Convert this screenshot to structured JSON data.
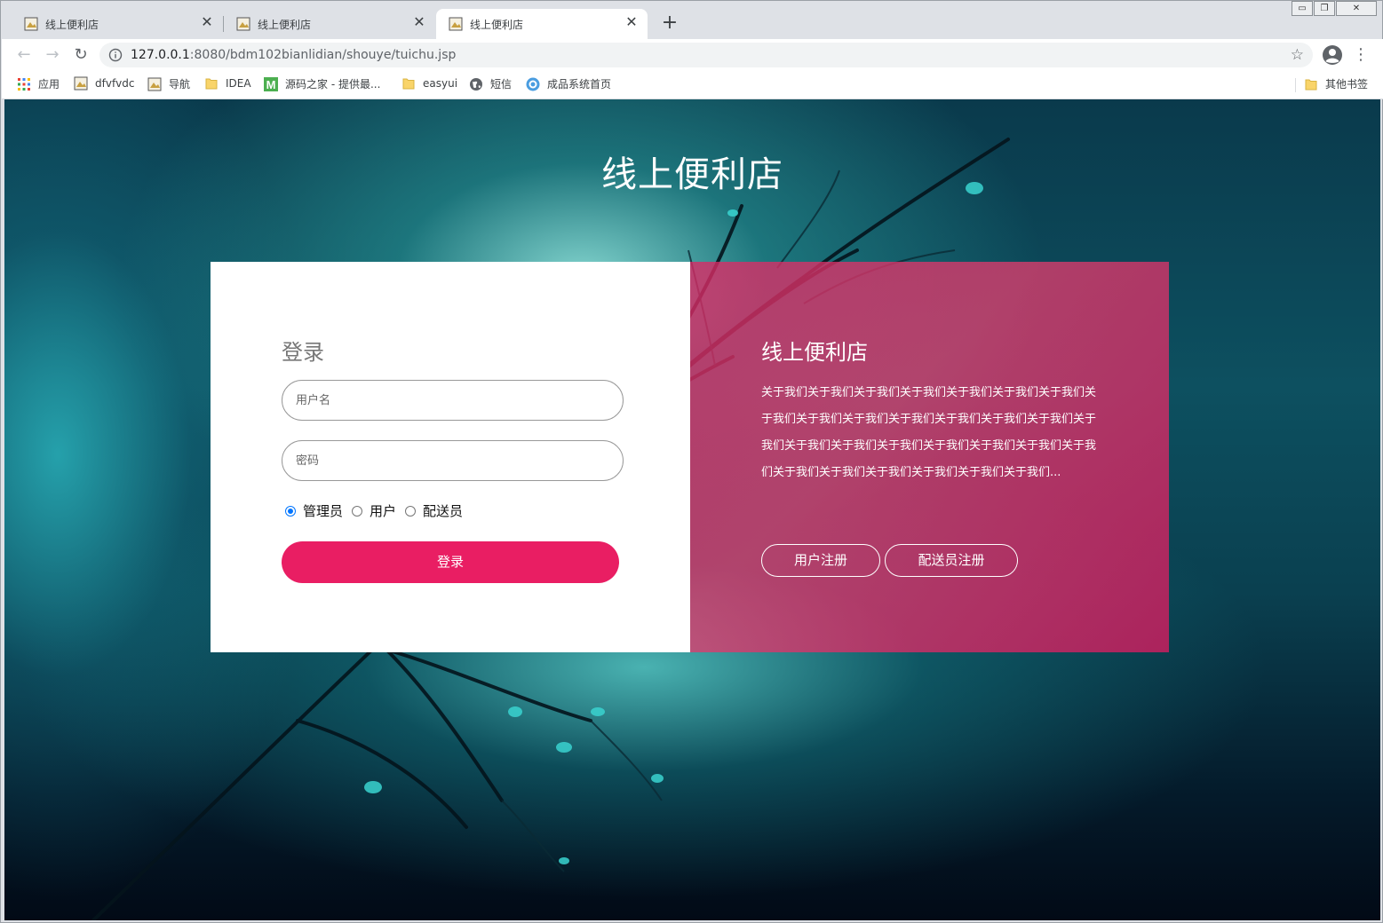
{
  "browser": {
    "tabs": [
      {
        "title": "线上便利店",
        "active": false
      },
      {
        "title": "线上便利店",
        "active": false
      },
      {
        "title": "线上便利店",
        "active": true
      }
    ],
    "new_tab_icon": "plus-icon",
    "window_controls": {
      "minimize": "▭",
      "restore": "❐",
      "close": "✕"
    },
    "url": {
      "host": "127.0.0.1",
      "path": ":8080/bdm102bianlidian/shouye/tuichu.jsp"
    },
    "bookmarks": [
      {
        "label": "应用",
        "icon": "apps-grid-icon"
      },
      {
        "label": "dfvfvdc",
        "icon": "page-image-icon"
      },
      {
        "label": "导航",
        "icon": "page-image-icon"
      },
      {
        "label": "IDEA",
        "icon": "folder-icon"
      },
      {
        "label": "源码之家 - 提供最...",
        "icon": "m-logo-icon"
      },
      {
        "label": "easyui",
        "icon": "folder-icon"
      },
      {
        "label": "短信",
        "icon": "globe-icon"
      },
      {
        "label": "成品系统首页",
        "icon": "blue-badge-icon"
      }
    ],
    "other_bookmarks": "其他书签"
  },
  "page": {
    "title": "线上便利店",
    "login": {
      "heading": "登录",
      "username_placeholder": "用户名",
      "password_placeholder": "密码",
      "roles": [
        "管理员",
        "用户",
        "配送员"
      ],
      "selected_role": "管理员",
      "submit_label": "登录"
    },
    "about": {
      "title": "线上便利店",
      "text": "关于我们关于我们关于我们关于我们关于我们关于我们关于我们关于我们关于我们关于我们关于我们关于我们关于我们关于我们关于我们关于我们关于我们关于我们关于我们关于我们关于我们关于我们关于我们关于我们关于我们关于我们关于我们关于我们...",
      "user_register_label": "用户注册",
      "courier_register_label": "配送员注册"
    }
  },
  "colors": {
    "accent": "#e91e63",
    "radio_checked": "#0075ff",
    "panel_overlay": "#dc2864"
  }
}
